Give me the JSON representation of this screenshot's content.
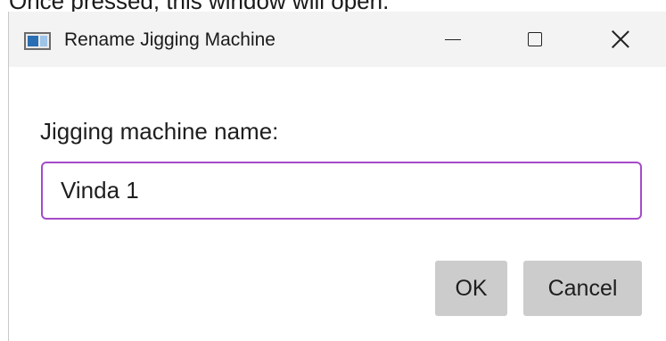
{
  "document": {
    "caption": "Once pressed, this window will open."
  },
  "window": {
    "title": "Rename Jigging Machine",
    "app_icon": "window-app-icon",
    "controls": {
      "minimize_icon": "minimize-icon",
      "maximize_icon": "maximize-icon",
      "close_icon": "close-icon"
    }
  },
  "form": {
    "name_label": "Jigging machine name:",
    "name_value": "Vinda 1"
  },
  "buttons": {
    "ok": "OK",
    "cancel": "Cancel"
  },
  "colors": {
    "input_focus_border": "#a64ac9",
    "button_background": "#cccccc",
    "titlebar_background": "#f3f3f3"
  }
}
